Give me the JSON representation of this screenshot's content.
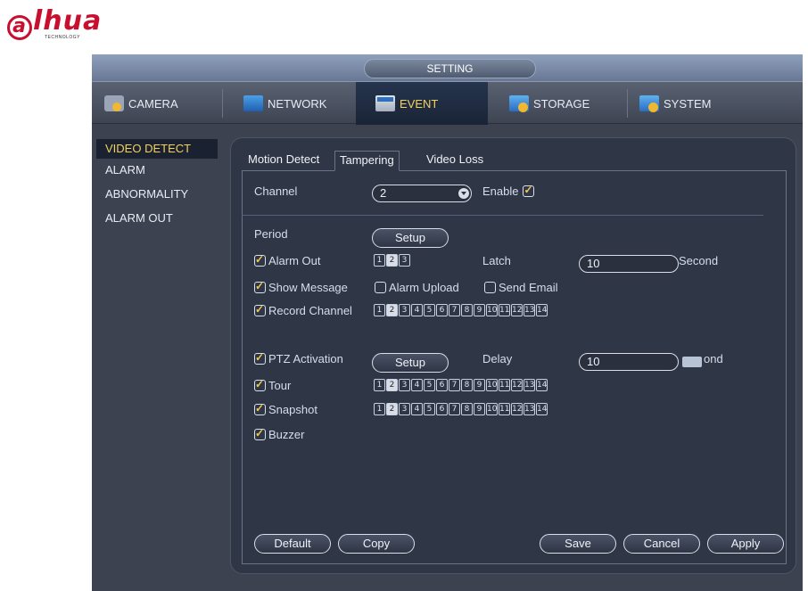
{
  "logo": {
    "brand": "alhua",
    "tagline": "TECHNOLOGY"
  },
  "window": {
    "title": "SETTING"
  },
  "main_tabs": [
    {
      "label": "CAMERA",
      "icon": "camera-icon"
    },
    {
      "label": "NETWORK",
      "icon": "network-icon"
    },
    {
      "label": "EVENT",
      "icon": "event-icon",
      "active": true
    },
    {
      "label": "STORAGE",
      "icon": "storage-icon"
    },
    {
      "label": "SYSTEM",
      "icon": "system-icon"
    }
  ],
  "sidebar": {
    "items": [
      {
        "label": "VIDEO DETECT",
        "active": true
      },
      {
        "label": "ALARM"
      },
      {
        "label": "ABNORMALITY"
      },
      {
        "label": "ALARM OUT"
      }
    ]
  },
  "sub_tabs": [
    {
      "label": "Motion Detect"
    },
    {
      "label": "Tampering",
      "active": true
    },
    {
      "label": "Video Loss"
    }
  ],
  "form": {
    "channel_label": "Channel",
    "channel_value": "2",
    "enable_label": "Enable",
    "enable_checked": true,
    "period_label": "Period",
    "setup_label": "Setup",
    "alarm_out_label": "Alarm Out",
    "alarm_out_channels": [
      "1",
      "2",
      "3"
    ],
    "alarm_out_selected": "2",
    "latch_label": "Latch",
    "latch_value": "10",
    "latch_unit": "Second",
    "show_message_label": "Show Message",
    "alarm_upload_label": "Alarm Upload",
    "send_email_label": "Send Email",
    "record_channel_label": "Record Channel",
    "channels_14": [
      "1",
      "2",
      "3",
      "4",
      "5",
      "6",
      "7",
      "8",
      "9",
      "10",
      "11",
      "12",
      "13",
      "14"
    ],
    "selected_channel": "2",
    "ptz_activation_label": "PTZ Activation",
    "ptz_setup_label": "Setup",
    "delay_label": "Delay",
    "delay_value": "10",
    "delay_unit_partial": "ond",
    "tour_label": "Tour",
    "snapshot_label": "Snapshot",
    "buzzer_label": "Buzzer"
  },
  "footer": {
    "default_label": "Default",
    "copy_label": "Copy",
    "save_label": "Save",
    "cancel_label": "Cancel",
    "apply_label": "Apply"
  },
  "colors": {
    "accent": "#f5d05a",
    "window_bg": "#3c4250",
    "panel_bg": "#2f3646",
    "brand_red": "#c8102e"
  }
}
